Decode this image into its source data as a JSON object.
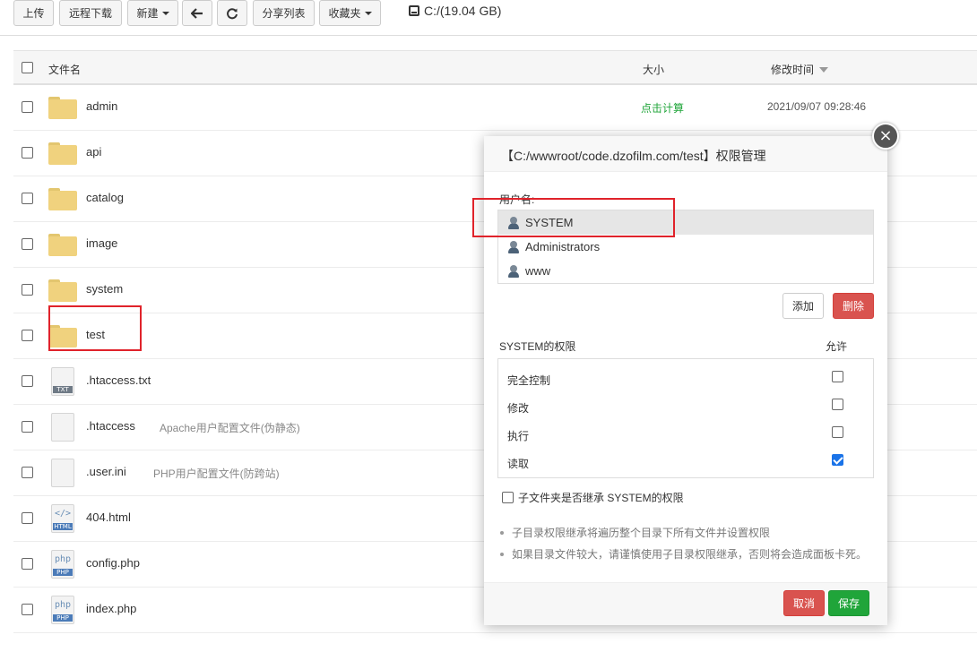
{
  "toolbar": {
    "upload": "上传",
    "remote_download": "远程下载",
    "new": "新建",
    "share_list": "分享列表",
    "favorites": "收藏夹",
    "disk": "C:/(19.04 GB)"
  },
  "table": {
    "headers": {
      "name": "文件名",
      "size": "大小",
      "mtime": "修改时间"
    },
    "rows": [
      {
        "name": "admin",
        "type": "folder",
        "size": "点击计算",
        "mtime": "2021/09/07 09:28:46",
        "desc": ""
      },
      {
        "name": "api",
        "type": "folder",
        "size": "",
        "mtime": "",
        "desc": ""
      },
      {
        "name": "catalog",
        "type": "folder",
        "size": "",
        "mtime": "",
        "desc": ""
      },
      {
        "name": "image",
        "type": "folder",
        "size": "",
        "mtime": "",
        "desc": ""
      },
      {
        "name": "system",
        "type": "folder",
        "size": "",
        "mtime": "",
        "desc": ""
      },
      {
        "name": "test",
        "type": "folder",
        "size": "",
        "mtime": "",
        "desc": ""
      },
      {
        "name": ".htaccess.txt",
        "type": "txt",
        "size": "",
        "mtime": "",
        "desc": ""
      },
      {
        "name": ".htaccess",
        "type": "file",
        "size": "",
        "mtime": "",
        "desc": "Apache用户配置文件(伪静态)"
      },
      {
        "name": ".user.ini",
        "type": "file",
        "size": "",
        "mtime": "",
        "desc": "PHP用户配置文件(防跨站)"
      },
      {
        "name": "404.html",
        "type": "html",
        "size": "",
        "mtime": "",
        "desc": ""
      },
      {
        "name": "config.php",
        "type": "php",
        "size": "",
        "mtime": "",
        "desc": ""
      },
      {
        "name": "index.php",
        "type": "php",
        "size": "",
        "mtime": "",
        "desc": ""
      }
    ],
    "badges": {
      "txt": "TXT",
      "html": "HTML",
      "php": "PHP"
    },
    "symbols": {
      "html": "</>",
      "php": "php"
    }
  },
  "dialog": {
    "title": "【C:/wwwroot/code.dzofilm.com/test】权限管理",
    "close": "×",
    "users_label": "用户名:",
    "users": [
      {
        "name": "SYSTEM",
        "selected": true
      },
      {
        "name": "Administrators",
        "selected": false
      },
      {
        "name": "www",
        "selected": false
      }
    ],
    "add": "添加",
    "delete": "删除",
    "perm_title": "SYSTEM的权限",
    "allow": "允许",
    "perms": [
      {
        "label": "完全控制",
        "checked": false
      },
      {
        "label": "修改",
        "checked": false
      },
      {
        "label": "执行",
        "checked": false
      },
      {
        "label": "读取",
        "checked": true
      }
    ],
    "inherit": "子文件夹是否继承 SYSTEM的权限",
    "notes": [
      "子目录权限继承将遍历整个目录下所有文件并设置权限",
      "如果目录文件较大，请谨慎使用子目录权限继承，否则将会造成面板卡死。"
    ],
    "cancel": "取消",
    "save": "保存"
  },
  "colors": {
    "green": "#20a53a",
    "danger": "#d9534f",
    "highlight": "#e0232b"
  }
}
